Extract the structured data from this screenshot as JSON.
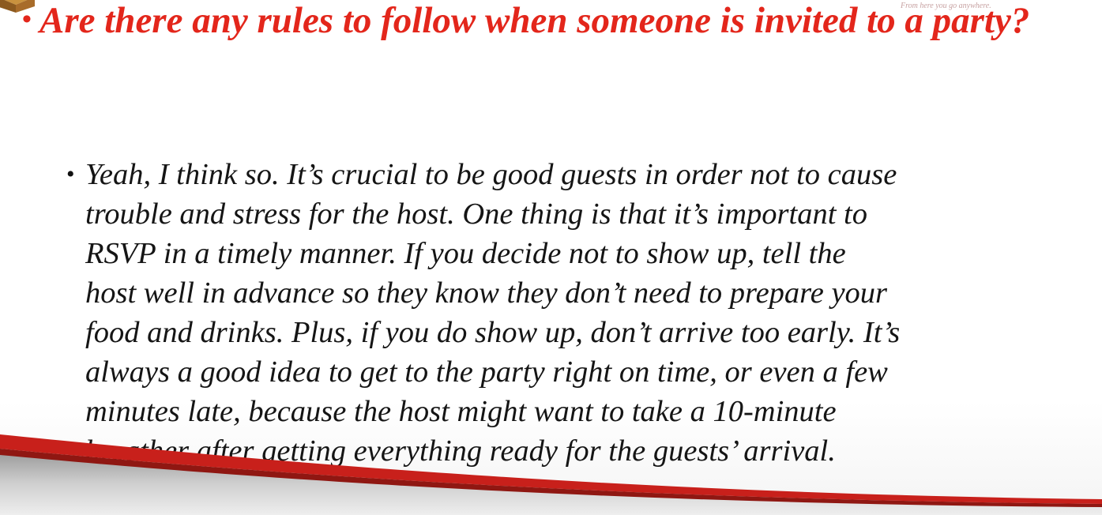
{
  "slide": {
    "watermark": "From here you go anywhere.",
    "question": "Are there any rules to follow when someone is invited to a party?",
    "answer_lines": [
      "Yeah, I think so. It’s crucial to be good guests in order not to cause",
      "trouble and stress for the host. One thing is that it’s important to",
      "RSVP in a timely manner. If you decide not to show up, tell the",
      "host well in advance so they know they don’t need to prepare your",
      "food and drinks. Plus, if you do show up, don’t arrive too early. It’s",
      "always a good idea to get to the party right on time, or even a few",
      "minutes late, because the host might want to take a 10-minute",
      "breather after getting everything ready for the guests’ arrival."
    ]
  },
  "colors": {
    "question": "#e3261b",
    "body_text": "#151515",
    "swoosh_red": "#c8201b",
    "swoosh_gray": "#b5b5b5"
  }
}
